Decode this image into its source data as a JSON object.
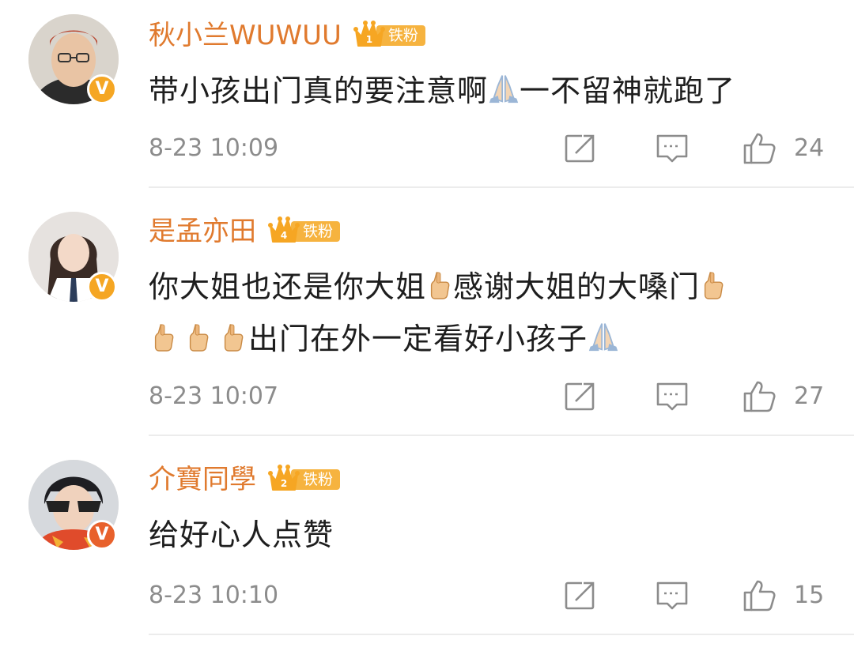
{
  "comments": [
    {
      "username": "秋小兰WUWUU",
      "fan_label": "铁粉",
      "fan_level": "1",
      "text_parts": [
        "带小孩出门真的要注意啊",
        "一不留神就跑了"
      ],
      "emojis": [
        "folded-hands"
      ],
      "time": "8-23 10:09",
      "likes": "24",
      "badge_color": "#f5a623"
    },
    {
      "username": "是孟亦田",
      "fan_label": "铁粉",
      "fan_level": "4",
      "text_parts": [
        "你大姐也还是你大姐",
        "感谢大姐的大嗓门",
        "出门在外一定看好小孩子"
      ],
      "emojis": [
        "thumbs-up",
        "thumbs-up",
        "thumbs-up",
        "thumbs-up",
        "thumbs-up",
        "folded-hands"
      ],
      "time": "8-23 10:07",
      "likes": "27",
      "badge_color": "#f5a623"
    },
    {
      "username": "介寶同學",
      "fan_label": "铁粉",
      "fan_level": "2",
      "text_parts": [
        "给好心人点赞"
      ],
      "emojis": [],
      "time": "8-23 10:10",
      "likes": "15",
      "badge_color": "#e8612c"
    }
  ],
  "icons": {
    "share": "share-icon",
    "comment": "comment-icon",
    "like": "thumbs-up-icon",
    "verified": "verified-badge-icon",
    "crown": "crown-icon"
  },
  "badge_text": "V",
  "colors": {
    "username": "#e07a2e",
    "timestamp": "#8c8c8c",
    "fan_badge": "#f6b33f",
    "divider": "#ececec"
  }
}
